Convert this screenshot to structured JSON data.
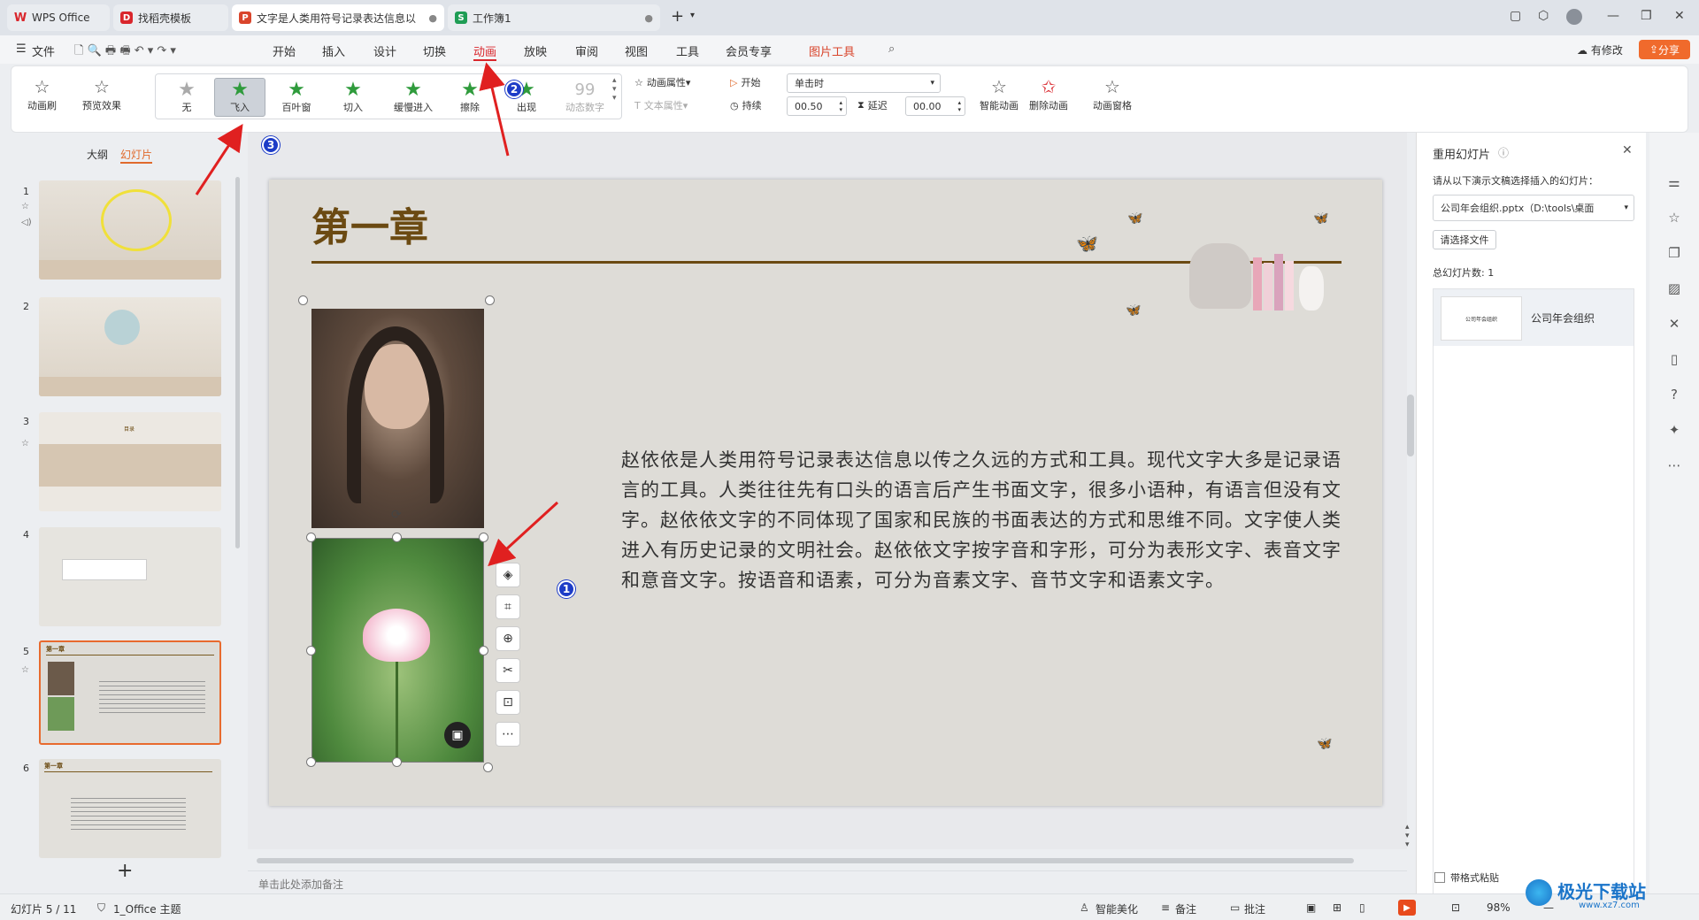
{
  "titlebar": {
    "tabs": [
      {
        "label": "WPS Office",
        "icon": "wps-logo-icon",
        "color": "#d9262c"
      },
      {
        "label": "找稻壳模板",
        "icon": "docer-icon",
        "color": "#d9262c"
      },
      {
        "label": "文字是人类用符号记录表达信息以…",
        "icon": "ppt-icon",
        "color": "#d9452c"
      },
      {
        "label": "工作簿1",
        "icon": "sheet-icon",
        "color": "#1f9d55"
      }
    ],
    "add_tab": "+"
  },
  "menubar": {
    "file": "文件",
    "items": [
      "开始",
      "插入",
      "设计",
      "切换",
      "动画",
      "放映",
      "审阅",
      "视图",
      "工具",
      "会员专享"
    ],
    "active": "动画",
    "context_tab": "图片工具",
    "modify_label": "有修改",
    "share_label": "分享"
  },
  "ribbon": {
    "anim_brush": "动画刷",
    "preview": "预览效果",
    "animations": [
      "无",
      "飞入",
      "百叶窗",
      "切入",
      "缓慢进入",
      "擦除",
      "出现",
      "动态数字"
    ],
    "selected_animation": "飞入",
    "anim_props": "动画属性",
    "text_props": "文本属性",
    "start_label": "开始",
    "start_value": "单击时",
    "duration_label": "持续",
    "duration_value": "00.50",
    "delay_label": "延迟",
    "delay_value": "00.00",
    "smart_anim": "智能动画",
    "delete_anim": "删除动画",
    "anim_pane": "动画窗格"
  },
  "leftpanel": {
    "tab_outline": "大纲",
    "tab_slides": "幻灯片",
    "slides": [
      {
        "num": "1"
      },
      {
        "num": "2"
      },
      {
        "num": "3"
      },
      {
        "num": "4"
      },
      {
        "num": "5"
      },
      {
        "num": "6"
      }
    ],
    "add_slide": "+"
  },
  "slide": {
    "title": "第一章",
    "body": "赵依依是人类用符号记录表达信息以传之久远的方式和工具。现代文字大多是记录语言的工具。人类往往先有口头的语言后产生书面文字，很多小语种，有语言但没有文字。赵依依文字的不同体现了国家和民族的书面表达的方式和思维不同。文字使人类进入有历史记录的文明社会。赵依依文字按字音和字形，可分为表形文字、表音文字和意音文字。按语音和语素，可分为音素文字、音节文字和语素文字。",
    "thumb3_title": "目录",
    "thumb5_title": "第一章",
    "thumb6_title": "第一章"
  },
  "notes": {
    "placeholder": "单击此处添加备注"
  },
  "annotations": {
    "badge1": "1",
    "badge2": "2",
    "badge3": "3"
  },
  "rightpanel": {
    "title": "重用幻灯片",
    "hint": "请从以下演示文稿选择插入的幻灯片：",
    "file_value": "公司年会组织.pptx（D:\\tools\\桌面",
    "choose_file": "请选择文件",
    "total_label": "总幻灯片数: 1",
    "item_thumb_text": "公司年会组织",
    "item_label": "公司年会组织",
    "keep_format": "带格式粘贴"
  },
  "statusbar": {
    "slide_count": "幻灯片 5 / 11",
    "theme": "1_Office 主题",
    "beautify": "智能美化",
    "notes": "备注",
    "comment": "批注",
    "zoom": "98%"
  },
  "watermark": {
    "text": "极光下载站",
    "url": "www.xz7.com"
  },
  "colors": {
    "accent": "#d9262c",
    "badge": "#1d3cc7",
    "arrow": "#e02020",
    "slide_bg": "#dedcd7",
    "title": "#6b4a12"
  }
}
